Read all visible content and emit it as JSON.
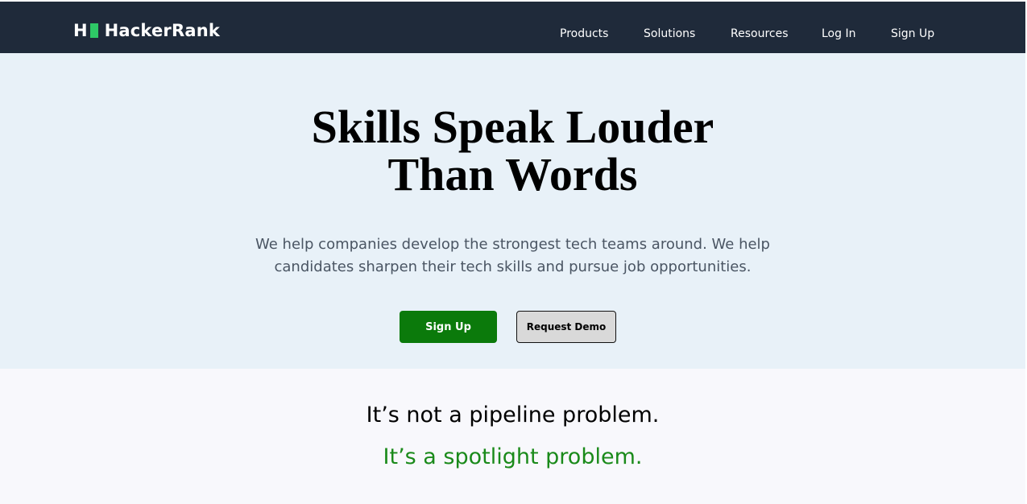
{
  "nav": {
    "logo_letter": "H",
    "logo_text": "HackerRank",
    "items": [
      "Products",
      "Solutions",
      "Resources",
      "Log In",
      "Sign Up"
    ]
  },
  "hero": {
    "title_line1": "Skills Speak Louder",
    "title_line2": "Than Words",
    "subtitle_line1": "We help companies develop the strongest tech teams around. We help",
    "subtitle_line2": "candidates sharpen their tech skills and pursue job opportunities.",
    "signup_label": "Sign Up",
    "demo_label": "Request Demo"
  },
  "tagline": {
    "line1": "It’s not a pipeline problem.",
    "line2": "It’s a spotlight problem."
  },
  "colors": {
    "navbar_bg": "#1f2a3a",
    "logo_accent": "#2ec866",
    "hero_bg": "#e8f1f8",
    "primary_button": "#0b7a0b",
    "spotlight_green": "#1a8a1a"
  }
}
